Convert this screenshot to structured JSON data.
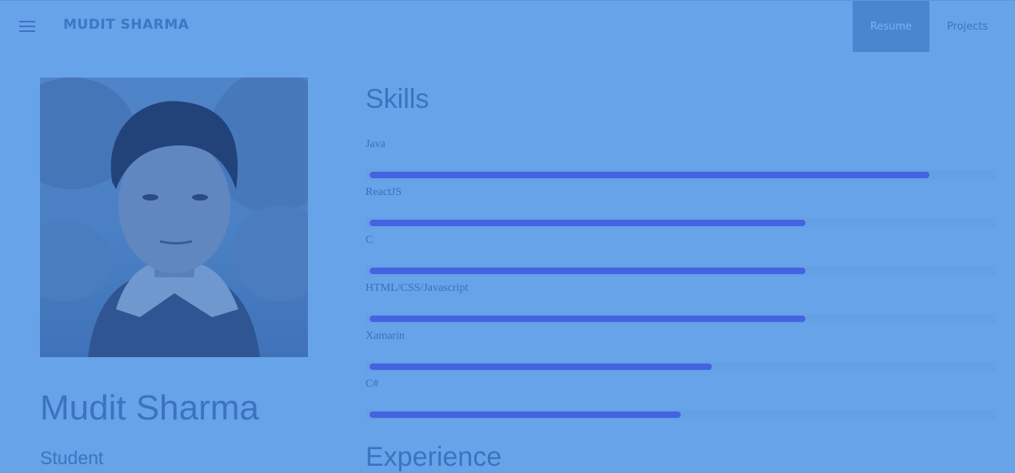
{
  "header": {
    "brand": "MUDIT SHARMA",
    "tabs": [
      {
        "label": "Resume",
        "active": true
      },
      {
        "label": "Projects",
        "active": false
      }
    ]
  },
  "profile": {
    "name": "Mudit Sharma",
    "role": "Student"
  },
  "skills": {
    "title": "Skills",
    "items": [
      {
        "label": "Java",
        "level": 0.9
      },
      {
        "label": "ReactJS",
        "level": 0.7
      },
      {
        "label": "C",
        "level": 0.7
      },
      {
        "label": "HTML/CSS/Javascript",
        "level": 0.7
      },
      {
        "label": "Xamarin",
        "level": 0.55
      },
      {
        "label": "C#",
        "level": 0.5
      }
    ]
  },
  "experience": {
    "title": "Experience"
  },
  "colors": {
    "background": "#67a3e8",
    "active_tab": "#4a86d0",
    "skill_bar": "#4363e0"
  }
}
